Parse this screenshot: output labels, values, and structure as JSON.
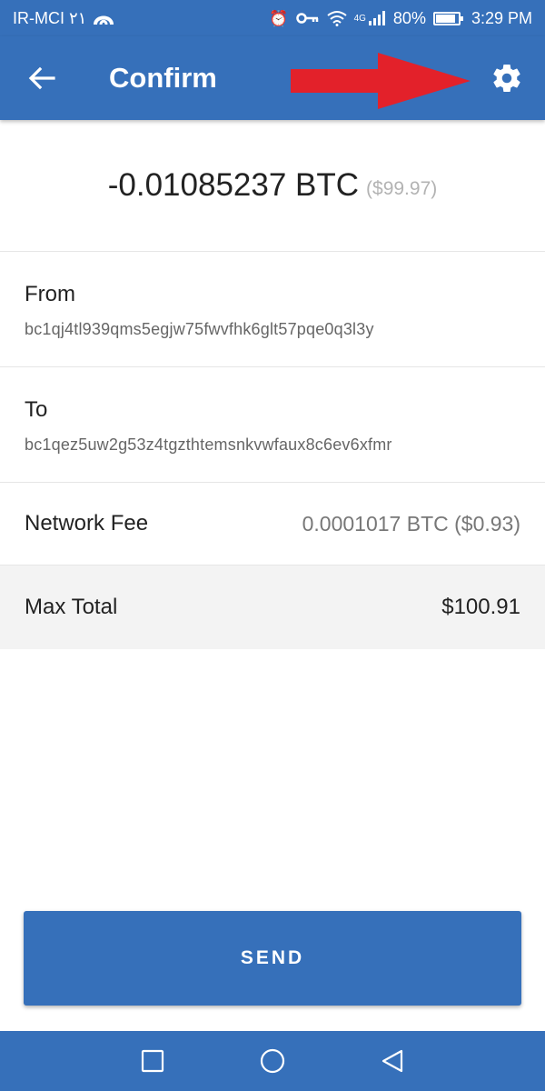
{
  "status_bar": {
    "carrier": "IR-MCI ٢١",
    "network": "4G",
    "battery": "80%",
    "time": "3:29 PM"
  },
  "app_bar": {
    "title": "Confirm"
  },
  "amount": {
    "crypto": "-0.01085237 BTC",
    "fiat": "($99.97)"
  },
  "from": {
    "label": "From",
    "address": "bc1qj4tl939qms5egjw75fwvfhk6glt57pqe0q3l3y"
  },
  "to": {
    "label": "To",
    "address": "bc1qez5uw2g53z4tgzthtemsnkvwfaux8c6ev6xfmr"
  },
  "network_fee": {
    "label": "Network Fee",
    "value": "0.0001017 BTC ($0.93)"
  },
  "max_total": {
    "label": "Max Total",
    "value": "$100.91"
  },
  "send_button": {
    "label": "SEND"
  },
  "colors": {
    "primary": "#3670ba",
    "annotation_arrow": "#e3212a",
    "total_row_bg": "#f3f3f3"
  },
  "icons": [
    "back-arrow-icon",
    "gear-icon",
    "alarm-icon",
    "key-icon",
    "wifi-icon",
    "signal-icon",
    "battery-icon",
    "square-icon",
    "circle-icon",
    "triangle-back-icon"
  ]
}
